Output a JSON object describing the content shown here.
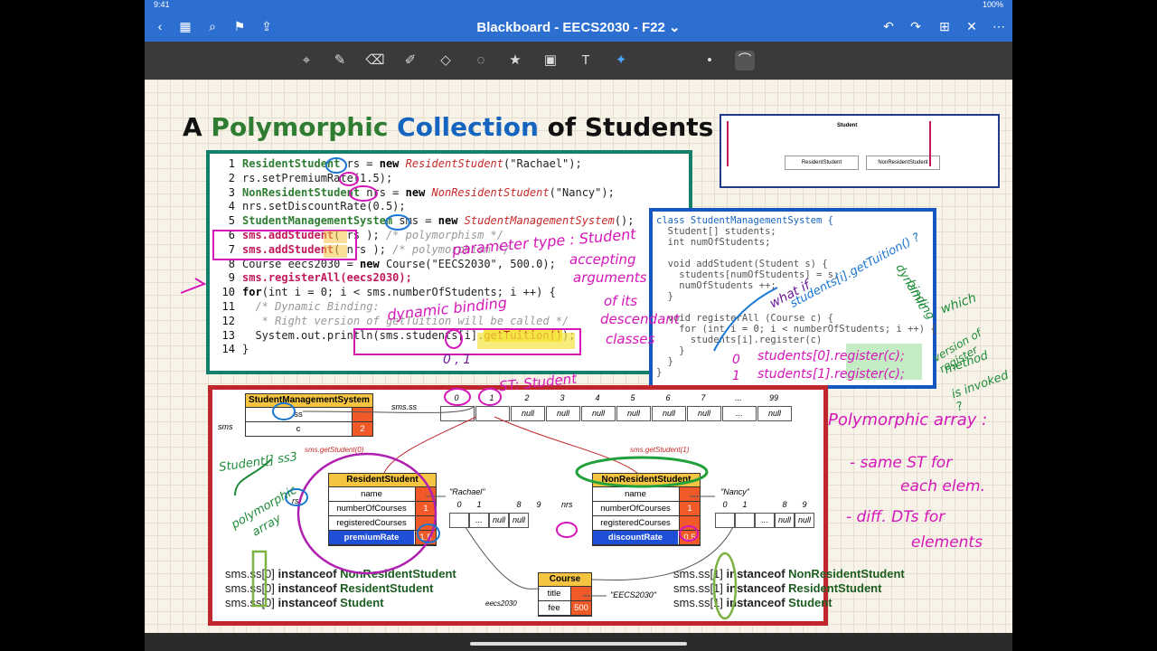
{
  "status": {
    "time": "9:41",
    "battery": "100%"
  },
  "app": {
    "title": "Blackboard - EECS2030 - F22",
    "title_chevron": "⌄"
  },
  "slide": {
    "title_a": "A",
    "title_poly": "Polymorphic",
    "title_coll": "Collection",
    "title_rest": "of Students"
  },
  "code_lines": [
    {
      "n": "1",
      "t1": "ResidentStudent",
      "t2": " rs = ",
      "t3": "new ",
      "t4": "ResidentStudent",
      "t5": "(\"Rachael\");"
    },
    {
      "n": "2",
      "t1": "",
      "t2": "rs.setPremiumRate(1.5);",
      "t3": "",
      "t4": "",
      "t5": ""
    },
    {
      "n": "3",
      "t1": "NonResidentStudent",
      "t2": " nrs = ",
      "t3": "new ",
      "t4": "NonResidentStudent",
      "t5": "(\"Nancy\");"
    },
    {
      "n": "4",
      "t1": "",
      "t2": "nrs.setDiscountRate(0.5);",
      "t3": "",
      "t4": "",
      "t5": ""
    },
    {
      "n": "5",
      "t1": "StudentManagementSystem",
      "t2": " sms = ",
      "t3": "new ",
      "t4": "StudentManagementSystem",
      "t5": "();"
    },
    {
      "n": "6",
      "t1": "sms.addStudent",
      "t2": "( rs ); ",
      "t3": "",
      "t4": "",
      "t5": "/* polymorphism */"
    },
    {
      "n": "7",
      "t1": "sms.addStudent",
      "t2": "( nrs );",
      "t3": "",
      "t4": "",
      "t5": " /* polymorphism */"
    },
    {
      "n": "8",
      "t1": "",
      "t2": "Course eecs2030 = ",
      "t3": "new ",
      "t4": "",
      "t5": "Course(\"EECS2030\", 500.0);"
    },
    {
      "n": "9",
      "t1": "sms.registerAll(eecs2030);",
      "t2": "",
      "t3": "",
      "t4": "",
      "t5": ""
    },
    {
      "n": "10",
      "t1": "",
      "t2": "for",
      "t3": "(int i = 0; i < sms.numberOfStudents; i ++) {",
      "t4": "",
      "t5": ""
    },
    {
      "n": "11",
      "t1": "",
      "t2": "",
      "t3": "",
      "t4": "",
      "t5": "  /* Dynamic Binding:"
    },
    {
      "n": "12",
      "t1": "",
      "t2": "",
      "t3": "",
      "t4": "",
      "t5": "   * Right version of getTuition will be called */"
    },
    {
      "n": "13",
      "t1": "",
      "t2": "  System.out.println(sms.students[i].",
      "t3": "getTuition()",
      "t4": "",
      "t5": ");"
    },
    {
      "n": "14",
      "t1": "",
      "t2": "}",
      "t3": "",
      "t4": "",
      "t5": ""
    }
  ],
  "class_code": [
    "class StudentManagementSystem {",
    "  Student[] students;",
    "  int numOfStudents;",
    "",
    "  void addStudent(Student s) {",
    "    students[numOfStudents] = s;",
    "    numOfStudents ++;",
    "  }",
    "",
    "  void registerAll (Course c) {",
    "    for (int i = 0; i < numberOfStudents; i ++) {",
    "      students[i].register(c)",
    "    }",
    "  }",
    "}"
  ],
  "diagram": {
    "sms_label": "sms",
    "sms_title": "StudentManagementSystem",
    "sms_ss": "ss",
    "sms_c": "c",
    "sms_c_val": "2",
    "sms_ss_label": "sms.ss",
    "array_indices": [
      "0",
      "1",
      "2",
      "3",
      "4",
      "5",
      "6",
      "7",
      "...",
      "99"
    ],
    "array_cells": [
      "",
      "",
      "null",
      "null",
      "null",
      "null",
      "null",
      "null",
      "...",
      "null"
    ],
    "get0": "sms.getStudent(0)",
    "get1": "sms.getStudent(1)",
    "rs_title": "ResidentStudent",
    "rs_rows": [
      {
        "k": "name",
        "v": ""
      },
      {
        "k": "numberOfCourses",
        "v": "1"
      },
      {
        "k": "registeredCourses",
        "v": ""
      },
      {
        "k": "premiumRate",
        "v": "1.5"
      }
    ],
    "rs_name": "\"Rachael\"",
    "nrs_title": "NonResidentStudent",
    "nrs_rows": [
      {
        "k": "name",
        "v": ""
      },
      {
        "k": "numberOfCourses",
        "v": "1"
      },
      {
        "k": "registeredCourses",
        "v": ""
      },
      {
        "k": "discountRate",
        "v": "0.5"
      }
    ],
    "nrs_name": "\"Nancy\"",
    "course_title": "Course",
    "course_rows": [
      {
        "k": "title",
        "v": ""
      },
      {
        "k": "fee",
        "v": "500"
      }
    ],
    "course_name": "\"EECS2030\"",
    "eecs_label": "eecs2030",
    "rs_label": "rs",
    "nrs_label": "nrs",
    "small_arr_left": [
      "0",
      "1",
      "",
      "8",
      "9"
    ],
    "small_arr_left_cells": [
      "",
      "...",
      "null",
      "null"
    ],
    "small_arr_right": [
      "0",
      "1",
      "",
      "8",
      "9"
    ],
    "small_arr_right_cells": [
      "",
      "",
      "...",
      "null",
      "null"
    ]
  },
  "instanceof_left": [
    {
      "a": "sms.ss[0]",
      "b": " instanceof ",
      "c": "NonResidentStudent"
    },
    {
      "a": "sms.ss[0]",
      "b": " instanceof ",
      "c": "ResidentStudent"
    },
    {
      "a": "sms.ss[0]",
      "b": " instanceof ",
      "c": "Student"
    }
  ],
  "instanceof_right": [
    {
      "a": "sms.ss[1]",
      "b": " instanceof ",
      "c": "NonResidentStudent"
    },
    {
      "a": "sms.ss[1]",
      "b": " instanceof ",
      "c": "ResidentStudent"
    },
    {
      "a": "sms.ss[1]",
      "b": " instanceof ",
      "c": "Student"
    }
  ],
  "handwriting": {
    "param_type": "parameter type : Student",
    "accepting": "accepting",
    "arguments": "arguments",
    "of_its": "of its",
    "descendant": "descendant",
    "classes": "classes",
    "dyn_binding": "dynamic binding",
    "zero_one": "0 , 1",
    "st_student": "ST: Student",
    "what_if": "what if",
    "students_call": "students[i].getTuition() ?",
    "dynamic": "dynamic",
    "binding": "binding",
    "which": "which",
    "version_of": "version of register",
    "method": "method",
    "is_invoked": "is invoked ?",
    "stud0": "students[0].register(c);",
    "stud1": "students[1].register(c);",
    "poly_array": "Polymorphic array :",
    "same_st": "- same ST for",
    "each_elem": "each elem.",
    "diff_dts": "- diff. DTs for",
    "elements": "elements",
    "student_ss3": "Student[] ss3",
    "polymorphic": "polymorphic",
    "array": "array",
    "t_mark": "T",
    "zero": "0",
    "one": "1"
  },
  "thumb": {
    "student": "Student",
    "resident": "ResidentStudent",
    "nonresident": "NonResidentStudent"
  }
}
